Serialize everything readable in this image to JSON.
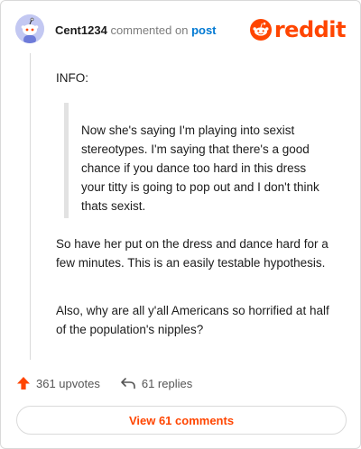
{
  "header": {
    "username": "Cent1234",
    "commented_text": "commented on",
    "post_link": "post",
    "brand": "reddit",
    "brand_color": "#ff4500"
  },
  "comment": {
    "info": "INFO:",
    "quote": "Now she's saying I'm playing into sexist stereotypes. I'm saying that there's a good chance if you dance too hard in this dress your titty is going to pop out and I don't think thats sexist.",
    "paragraph_2": "So have her put on the dress and dance hard for a few minutes. This is an easily testable hypothesis.",
    "paragraph_3": "Also, why are all y'all Americans so horrified at half of the population's nipples?"
  },
  "actions": {
    "upvotes": "361 upvotes",
    "replies": "61 replies",
    "upvote_icon": "arrow-up-icon",
    "reply_icon": "reply-arrow-icon"
  },
  "footer": {
    "view_comments": "View 61 comments"
  },
  "icons": {
    "avatar": "snoo-avatar-icon",
    "logo": "reddit-alien-icon"
  }
}
